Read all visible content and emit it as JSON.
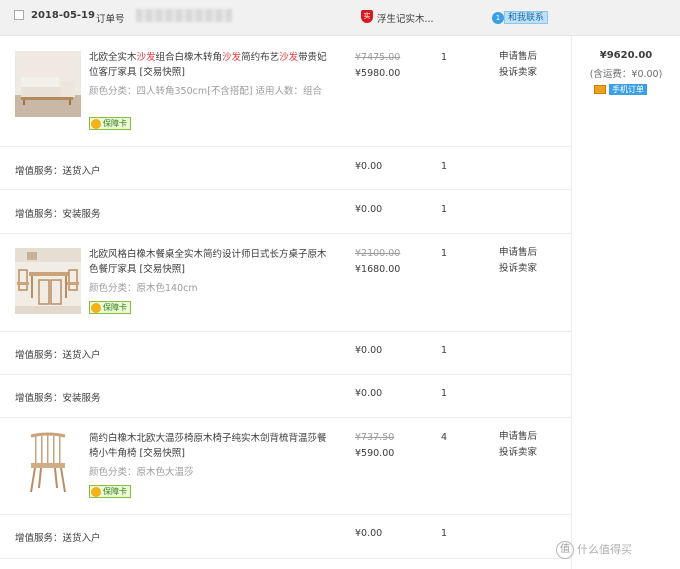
{
  "header": {
    "date": "2018-05-19",
    "order_label": "订单号",
    "shop_name": "浮生记实木...",
    "shop_icon": "实",
    "contact_icon": "1",
    "contact_label": "和我联系"
  },
  "summary": {
    "total": "¥9620.00",
    "shipping": "(含运费：¥0.00)",
    "mobile_order": "手机订单"
  },
  "products": [
    {
      "title_parts": [
        "北欧全实木",
        "沙发",
        "组合白橡木转角",
        "沙发",
        "简约布艺",
        "沙发",
        "带贵妃位客厅家具 [交易快照]"
      ],
      "spec": "颜色分类：四人转角350cm[不含搭配]  适用人数：组合",
      "badge": "保障卡",
      "original_price": "¥7475.00",
      "price": "¥5980.00",
      "qty": "1",
      "action1": "申请售后",
      "action2": "投诉卖家"
    },
    {
      "title": "北欧风格白橡木餐桌全实木简约设计师日式长方桌子原木色餐厅家具 [交易快照]",
      "spec": "颜色分类：原木色140cm",
      "badge": "保障卡",
      "original_price": "¥2100.00",
      "price": "¥1680.00",
      "qty": "1",
      "action1": "申请售后",
      "action2": "投诉卖家"
    },
    {
      "title": "简约白橡木北欧大温莎椅原木椅子纯实木剑背梳背温莎餐椅小牛角椅 [交易快照]",
      "spec": "颜色分类：原木色大温莎",
      "badge": "保障卡",
      "original_price": "¥737.50",
      "price": "¥590.00",
      "qty": "4",
      "action1": "申请售后",
      "action2": "投诉卖家"
    }
  ],
  "services": {
    "delivery": "增值服务：送货入户",
    "install": "增值服务：安装服务",
    "price": "¥0.00",
    "qty": "1"
  },
  "watermark": {
    "glyph": "值",
    "text": "什么值得买"
  }
}
